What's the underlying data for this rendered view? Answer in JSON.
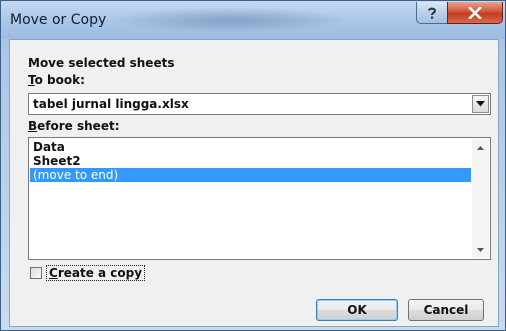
{
  "window": {
    "title": "Move or Copy",
    "help_glyph": "?",
    "close_glyph": "X"
  },
  "dialog": {
    "heading": "Move selected sheets",
    "to_book": {
      "accesskey": "T",
      "rest": "o book:"
    },
    "book_value": "tabel jurnal lingga.xlsx",
    "before_sheet": {
      "accesskey": "B",
      "rest": "efore sheet:"
    },
    "sheets": [
      {
        "label": "Data",
        "selected": false
      },
      {
        "label": "Sheet2",
        "selected": false
      },
      {
        "label": "(move to end)",
        "selected": true
      }
    ],
    "create_copy": {
      "accesskey": "C",
      "rest": "reate a copy",
      "checked": false
    },
    "ok_label": "OK",
    "cancel_label": "Cancel"
  },
  "colors": {
    "selection": "#3399ff",
    "close_button": "#c23c20",
    "title_bar": "#a9c5e7"
  },
  "icons": [
    "help-icon",
    "close-icon",
    "chevron-down-icon",
    "scroll-up-icon",
    "scroll-down-icon"
  ]
}
